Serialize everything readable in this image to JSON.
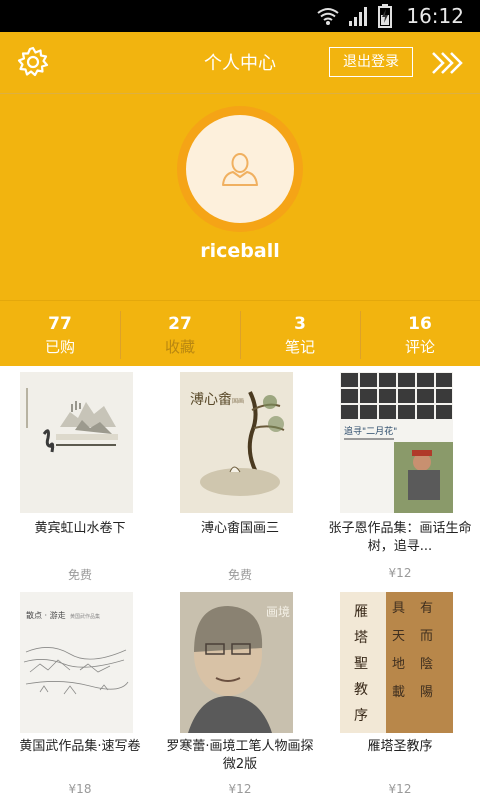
{
  "status_bar": {
    "time": "16:12",
    "icons": [
      "wifi-icon",
      "signal-icon",
      "battery-icon"
    ]
  },
  "header": {
    "title": "个人中心",
    "logout_label": "退出登录",
    "settings_icon": "gear-icon",
    "more_icon": "double-chevron-right-icon"
  },
  "profile": {
    "username": "riceball",
    "avatar_icon": "person-icon"
  },
  "stats": [
    {
      "count": "77",
      "label": "已购"
    },
    {
      "count": "27",
      "label": "收藏"
    },
    {
      "count": "3",
      "label": "笔记"
    },
    {
      "count": "16",
      "label": "评论"
    }
  ],
  "books": [
    {
      "title": "黄宾虹山水卷下",
      "price": "免费"
    },
    {
      "title": "溥心畬国画三",
      "price": "免费"
    },
    {
      "title": "张子恩作品集：画话生命树，追寻...",
      "price": "¥12"
    },
    {
      "title": "黄国武作品集·速写卷",
      "price": "¥18"
    },
    {
      "title": "罗寒蕾·画境工笔人物画探微2版",
      "price": "¥12"
    },
    {
      "title": "雁塔圣教序",
      "price": "¥12"
    }
  ],
  "colors": {
    "accent": "#f2b40f",
    "avatar_ring": "#f5a416",
    "active_tab_label": "#b98710"
  }
}
